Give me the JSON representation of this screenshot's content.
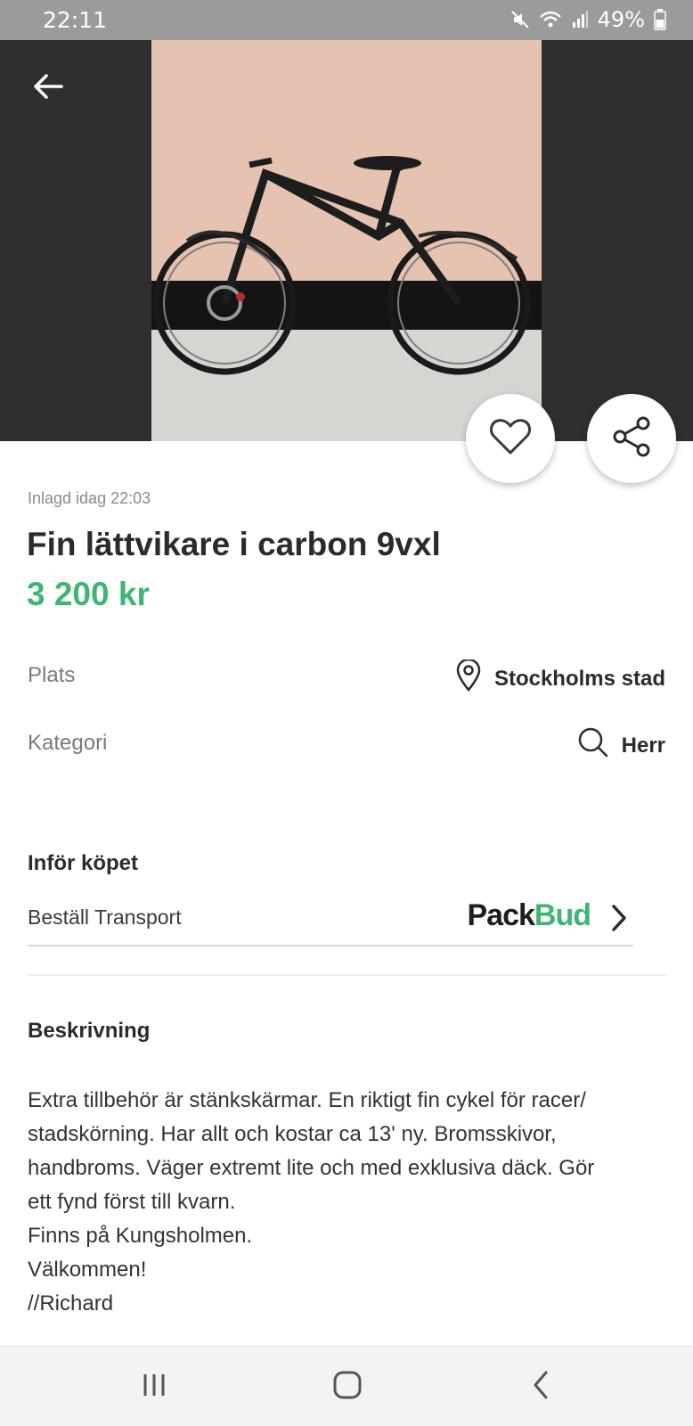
{
  "status_bar": {
    "time": "22:11",
    "battery": "49%",
    "icons": [
      "mute-icon",
      "wifi-icon",
      "signal-icon",
      "battery-icon"
    ]
  },
  "header": {
    "back_icon": "arrow-left-icon",
    "favorite_icon": "heart-icon",
    "share_icon": "share-icon"
  },
  "listing": {
    "posted": "Inlagd idag 22:03",
    "title": "Fin lättvikare i carbon 9vxl",
    "price": "3 200 kr",
    "price_color": "#3fb574"
  },
  "details": {
    "place_label": "Plats",
    "place_value": "Stockholms stad",
    "place_icon": "location-pin-icon",
    "category_label": "Kategori",
    "category_value": "Herr",
    "category_icon": "search-icon"
  },
  "before_purchase": {
    "heading": "Inför köpet",
    "transport_label": "Beställ Transport",
    "brand_part1": "Pack",
    "brand_part2": "Bud"
  },
  "description": {
    "heading": "Beskrivning",
    "lines": [
      "Extra tillbehör är stänkskärmar. En riktigt fin cykel för racer/",
      "stadskörning. Har allt och kostar ca 13' ny. Bromsskivor,",
      "handbroms. Väger extremt lite och med exklusiva däck. Gör",
      "ett fynd först till kvarn.",
      "Finns på Kungsholmen.",
      "Välkommen!",
      "//Richard"
    ]
  },
  "nav": {
    "icons": [
      "recents-icon",
      "home-icon",
      "back-icon"
    ]
  }
}
